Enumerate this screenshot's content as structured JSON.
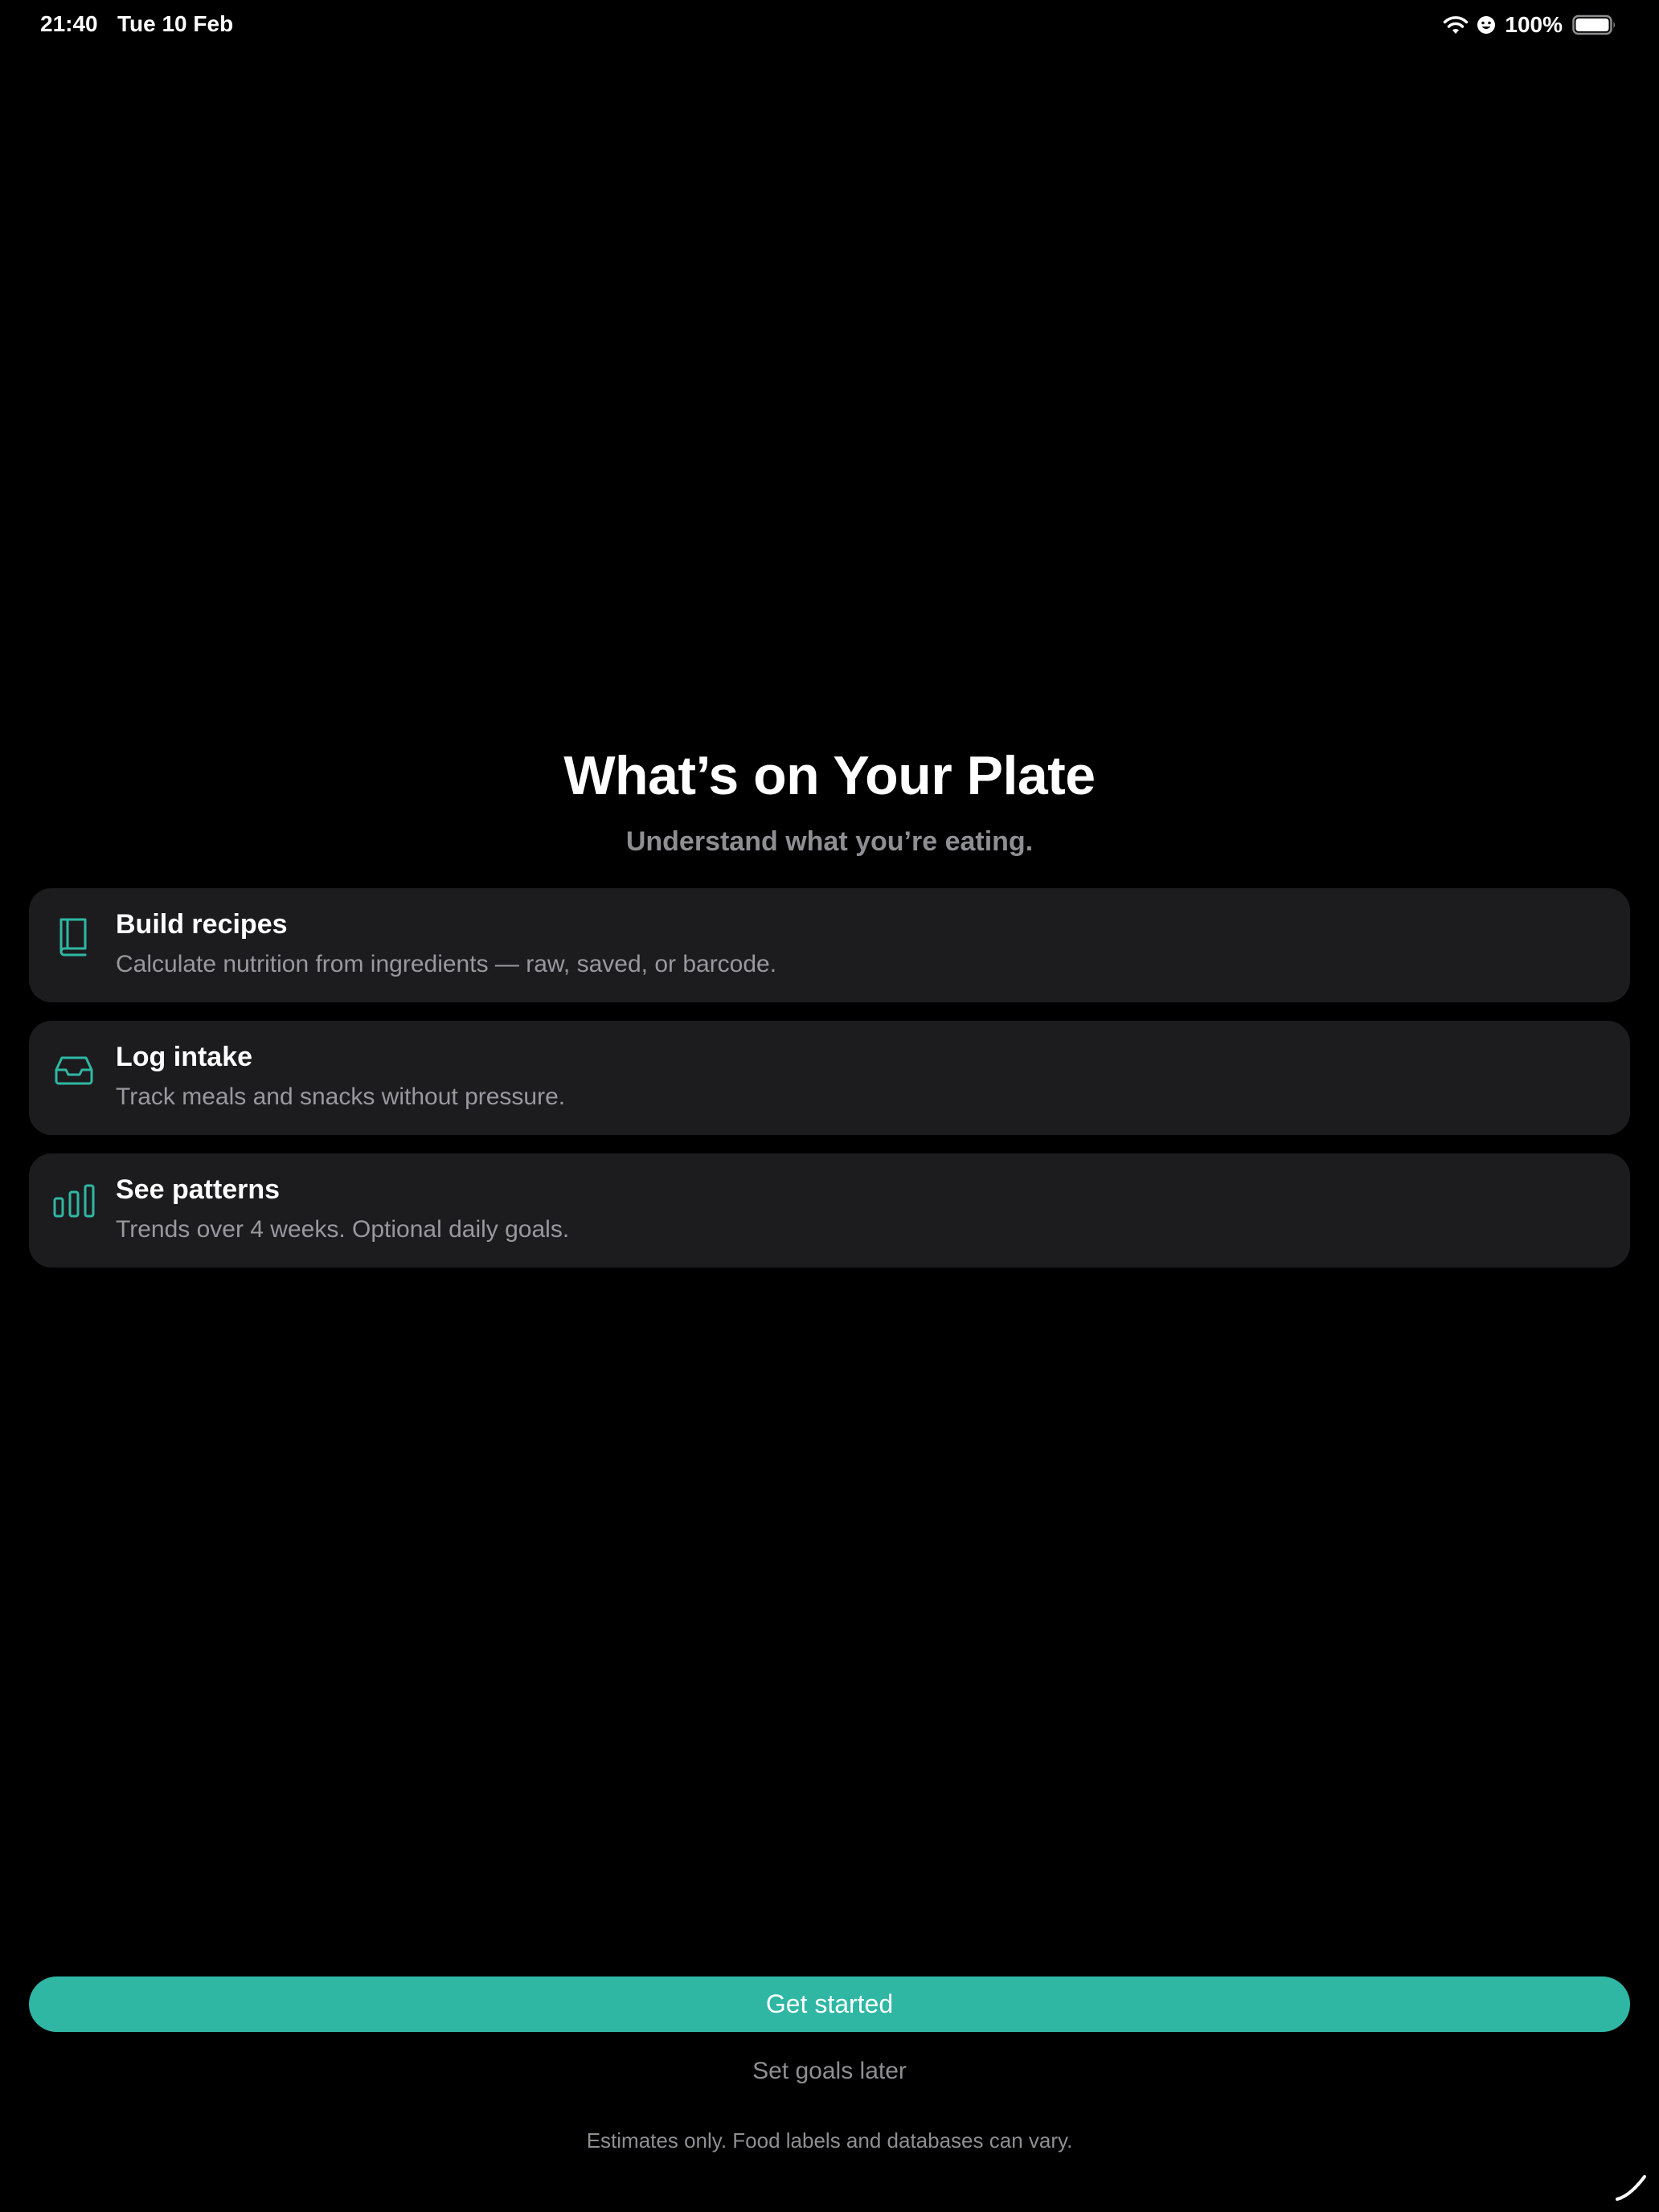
{
  "status_bar": {
    "time": "21:40",
    "date": "Tue 10 Feb",
    "battery_percent": "100%",
    "battery_level": 1.0,
    "icons": [
      "wifi-icon",
      "focus-smiley-icon",
      "battery-icon"
    ]
  },
  "header": {
    "title": "What’s on Your Plate",
    "subtitle": "Understand what you’re eating."
  },
  "features": [
    {
      "icon": "book-icon",
      "title": "Build recipes",
      "description": "Calculate nutrition from ingredients — raw, saved, or barcode."
    },
    {
      "icon": "tray-icon",
      "title": "Log intake",
      "description": "Track meals and snacks without pressure."
    },
    {
      "icon": "bar-chart-icon",
      "title": "See patterns",
      "description": "Trends over 4 weeks. Optional daily goals."
    }
  ],
  "actions": {
    "primary_label": "Get started",
    "secondary_label": "Set goals later"
  },
  "disclaimer": "Estimates only. Food labels and databases can vary.",
  "colors": {
    "background": "#000000",
    "card": "#1c1c1e",
    "accent": "#2fb7a4",
    "secondary_text": "#8e8e93"
  }
}
